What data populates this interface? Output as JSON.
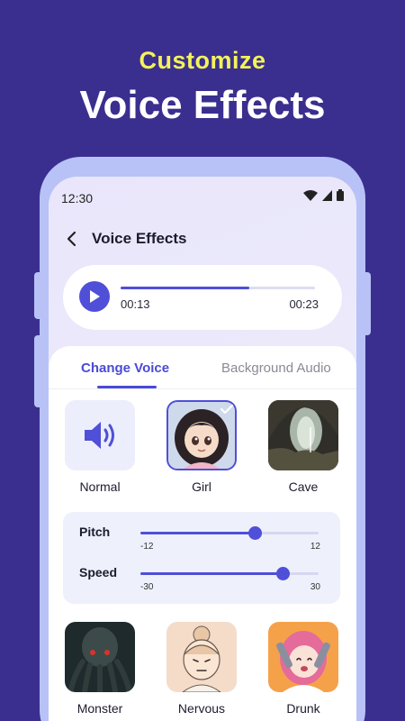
{
  "promo": {
    "line1": "Customize",
    "line2": "Voice Effects"
  },
  "status": {
    "time": "12:30"
  },
  "header": {
    "title": "Voice Effects"
  },
  "player": {
    "current": "00:13",
    "total": "00:23",
    "progress": 0.66
  },
  "tabs": [
    {
      "label": "Change Voice",
      "active": true
    },
    {
      "label": "Background Audio",
      "active": false
    }
  ],
  "voices_row1": [
    {
      "label": "Normal",
      "icon": "speaker-icon",
      "selected": false
    },
    {
      "label": "Girl",
      "icon": "girl-avatar",
      "selected": true
    },
    {
      "label": "Cave",
      "icon": "cave-image",
      "selected": false
    }
  ],
  "sliders": [
    {
      "label": "Pitch",
      "min": "-12",
      "max": "12",
      "value": 0.64
    },
    {
      "label": "Speed",
      "min": "-30",
      "max": "30",
      "value": 0.8
    }
  ],
  "voices_row2": [
    {
      "label": "Monster",
      "icon": "monster-image"
    },
    {
      "label": "Nervous",
      "icon": "nervous-avatar"
    },
    {
      "label": "Drunk",
      "icon": "drunk-avatar"
    }
  ],
  "colors": {
    "accent": "#4f4fd8",
    "background": "#3a2f8f",
    "headline": "#f3f35a"
  }
}
